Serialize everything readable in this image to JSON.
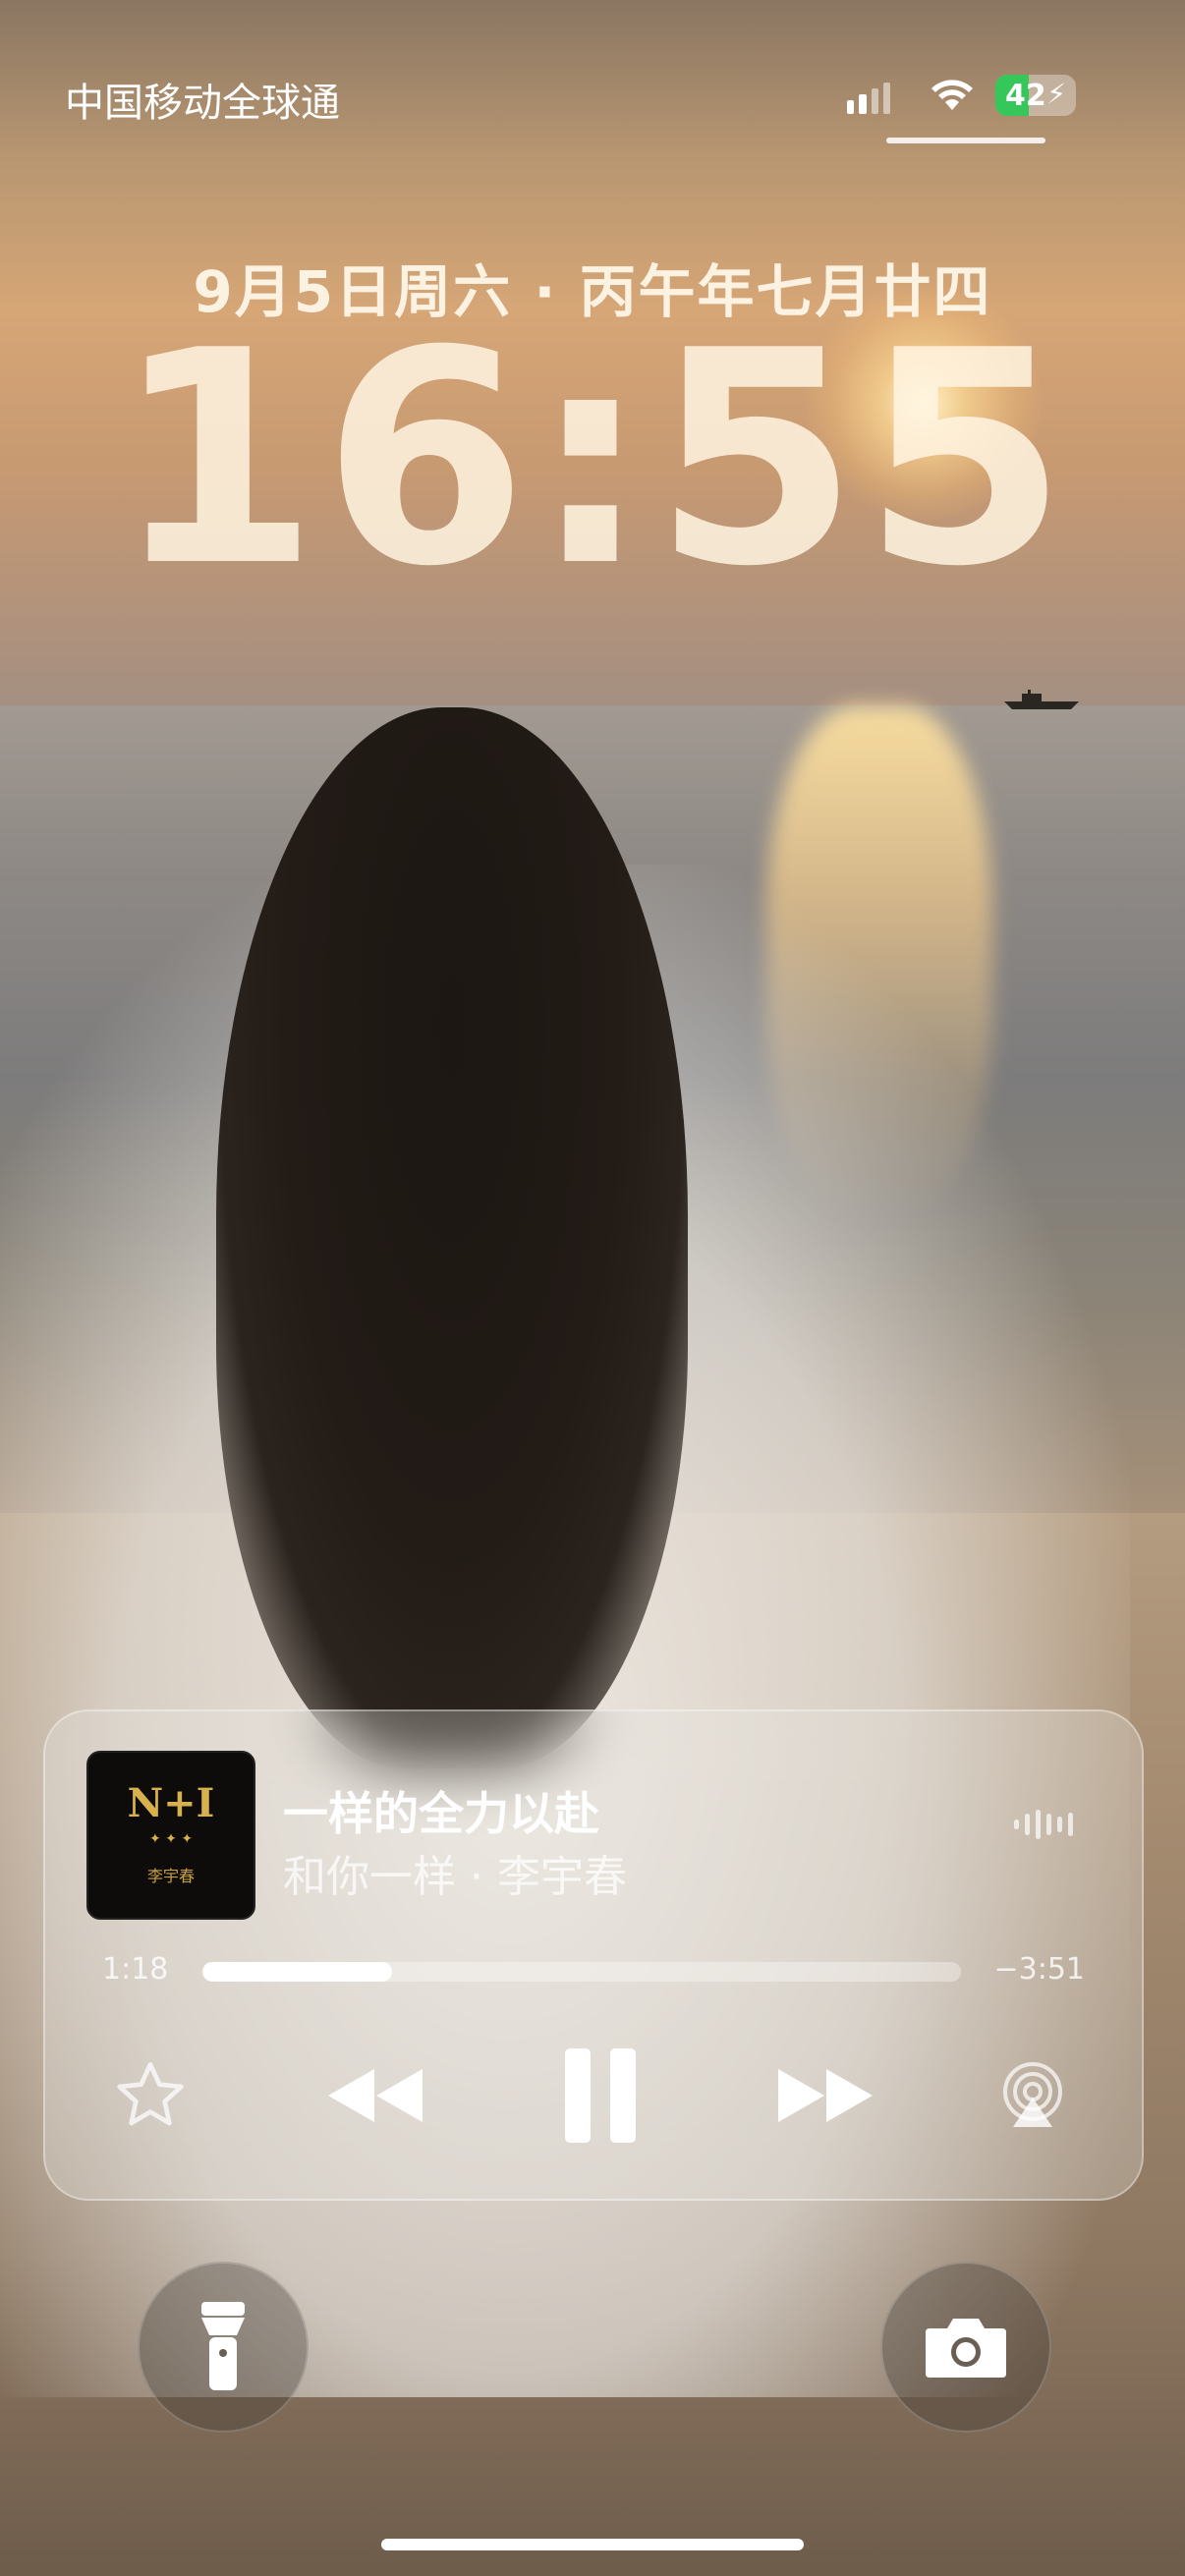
{
  "status_bar": {
    "carrier": "中国移动全球通",
    "battery_level": "42",
    "icons": [
      "signal-icon",
      "wifi-icon",
      "battery-charging-icon"
    ]
  },
  "lock_screen": {
    "date": "9月5日周六 · 丙午年七月廿四",
    "time": "16:55"
  },
  "now_playing": {
    "song_title": "一样的全力以赴",
    "subtitle": "和你一样 · 李宇春",
    "elapsed": "1:18",
    "remaining": "−3:51",
    "progress": 0.25,
    "album_art": {
      "logo": "N+I",
      "tag": "李宇春"
    },
    "controls": [
      "favorite-star-icon",
      "previous-icon",
      "pause-icon",
      "next-icon",
      "airplay-icon"
    ]
  },
  "quick_actions": [
    "flashlight-icon",
    "camera-icon"
  ],
  "colors": {
    "accent_battery": "#35c759",
    "text": "#ffffff"
  }
}
